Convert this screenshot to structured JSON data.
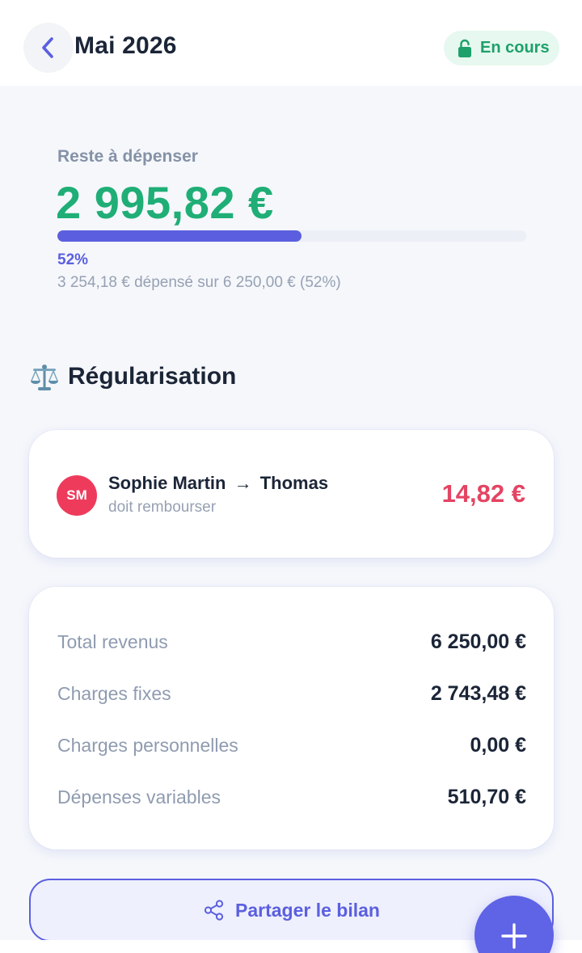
{
  "header": {
    "title": "Mai 2026",
    "status_badge": "En cours"
  },
  "budget": {
    "remaining_label": "Reste à dépenser",
    "remaining_amount": "2 995,82 €",
    "progress_percent_label": "52%",
    "progress_fraction": 0.52,
    "progress_detail": "3 254,18 € dépensé sur 6 250,00 € (52%)"
  },
  "regularisation": {
    "title": "Régularisation",
    "settlement": {
      "avatar_initials": "SM",
      "from": "Sophie Martin",
      "arrow": "→",
      "to": "Thomas",
      "description": "doit rembourser",
      "amount": "14,82 €"
    }
  },
  "totals": [
    {
      "label": "Total revenus",
      "value": "6 250,00 €"
    },
    {
      "label": "Charges fixes",
      "value": "2 743,48 €"
    },
    {
      "label": "Charges personnelles",
      "value": "0,00 €"
    },
    {
      "label": "Dépenses variables",
      "value": "510,70 €"
    }
  ],
  "actions": {
    "share_label": "Partager le bilan"
  },
  "icons": {
    "back": "chevron-left-icon",
    "status": "unlock-icon",
    "section": "balance-scale-icon",
    "share": "share-icon",
    "fab": "plus-icon"
  },
  "colors": {
    "accent": "#5b5fdf",
    "positive": "#1fae76",
    "negative": "#e44463",
    "badge_bg": "#e6f8ef",
    "badge_text": "#1ea06a"
  }
}
